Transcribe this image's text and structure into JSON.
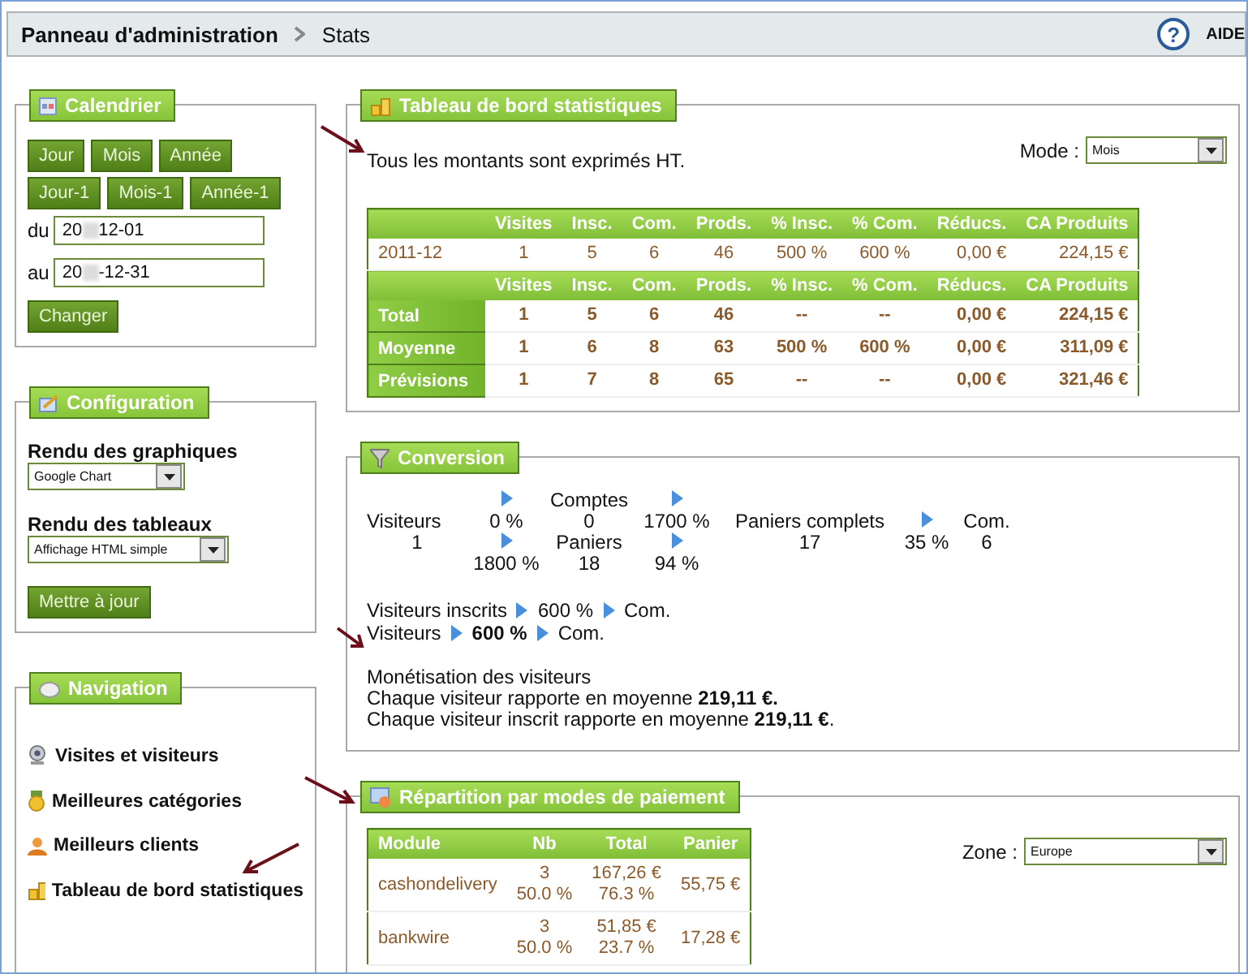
{
  "header": {
    "breadcrumb": [
      {
        "label": "Panneau d'administration"
      },
      {
        "label": "Stats"
      }
    ],
    "help_icon": "?",
    "help": "AIDE"
  },
  "calendar": {
    "title": "Calendrier",
    "button_rows": [
      [
        "Jour",
        "Mois",
        "Année"
      ],
      [
        "Jour-1",
        "Mois-1",
        "Année-1"
      ]
    ],
    "dates": [
      {
        "label": "du",
        "start": "20",
        "end": "12-01"
      },
      {
        "label": "au",
        "start": "20",
        "end": "-12-31"
      }
    ],
    "submit": "Changer"
  },
  "configuration": {
    "title": "Configuration",
    "settings": [
      {
        "label": "Rendu des graphiques",
        "value": "Google Chart"
      },
      {
        "label": "Rendu des tableaux",
        "value": "Affichage HTML simple"
      }
    ],
    "submit": "Mettre à jour"
  },
  "navigation": {
    "title": "Navigation",
    "items": [
      {
        "label": "Visites et visiteurs",
        "kind": "webcam"
      },
      {
        "label": "Meilleures catégories",
        "kind": "medal"
      },
      {
        "label": "Meilleurs clients",
        "kind": "person"
      },
      {
        "label": "Tableau de bord statistiques",
        "kind": "coins"
      }
    ]
  },
  "dashboard": {
    "title": "Tableau de bord statistiques",
    "note": "Tous les montants sont exprimés HT.",
    "mode_label": "Mode :",
    "mode_value": "Mois",
    "columns": [
      "",
      "Visites",
      "Insc.",
      "Com.",
      "Prods.",
      "% Insc.",
      "% Com.",
      "Réducs.",
      "CA Produits"
    ],
    "rows": [
      [
        "2011-12",
        "1",
        "5",
        "6",
        "46",
        "500 %",
        "600 %",
        "0,00 €",
        "224,15 €"
      ]
    ],
    "summary_columns": [
      "",
      "Visites",
      "Insc.",
      "Com.",
      "Prods.",
      "% Insc.",
      "% Com.",
      "Réducs.",
      "CA Produits"
    ],
    "summary_rows": [
      [
        "Total",
        "1",
        "5",
        "6",
        "46",
        "--",
        "--",
        "0,00 €",
        "224,15 €"
      ],
      [
        "Moyenne",
        "1",
        "6",
        "8",
        "63",
        "500 %",
        "600 %",
        "0,00 €",
        "311,09 €"
      ],
      [
        "Prévisions",
        "1",
        "7",
        "8",
        "65",
        "--",
        "--",
        "0,00 €",
        "321,46 €"
      ]
    ]
  },
  "conversion": {
    "title": "Conversion",
    "funnel": {
      "visitors_label": "Visiteurs",
      "visitors_value": "1",
      "to_accounts": "0 %",
      "accounts_label": "Comptes",
      "accounts_value": "0",
      "accounts_to_complete": "1700 %",
      "to_carts": "1800 %",
      "carts_label": "Paniers",
      "carts_value": "18",
      "carts_to_complete": "94 %",
      "complete_label": "Paniers complets",
      "complete_value": "17",
      "complete_to_orders": "35 %",
      "orders_label": "Com.",
      "orders_value": "6"
    },
    "flows": [
      {
        "from": "Visiteurs inscrits",
        "rate": "600 %",
        "to": "Com.",
        "bold": false
      },
      {
        "from": "Visiteurs",
        "rate": "600 %",
        "to": "Com.",
        "bold": true
      }
    ],
    "monetization": {
      "title": "Monétisation des visiteurs",
      "lines": [
        "Chaque visiteur rapporte en moyenne **219,11 €.**",
        "Chaque visiteur inscrit rapporte en moyenne **219,11 €**."
      ]
    }
  },
  "payments": {
    "title": "Répartition par modes de paiement",
    "zone_label": "Zone :",
    "zone_value": "Europe",
    "columns": [
      "Module",
      "Nb",
      "Total",
      "Panier"
    ],
    "rows": [
      {
        "module": "cashondelivery",
        "nb": "3",
        "nb_share": "50.0 %",
        "total": "167,26 €",
        "total_share": "76.3 %",
        "average": "55,75 €"
      },
      {
        "module": "bankwire",
        "nb": "3",
        "nb_share": "50.0 %",
        "total": "51,85 €",
        "total_share": "23.7 %",
        "average": "17,28 €"
      }
    ]
  }
}
